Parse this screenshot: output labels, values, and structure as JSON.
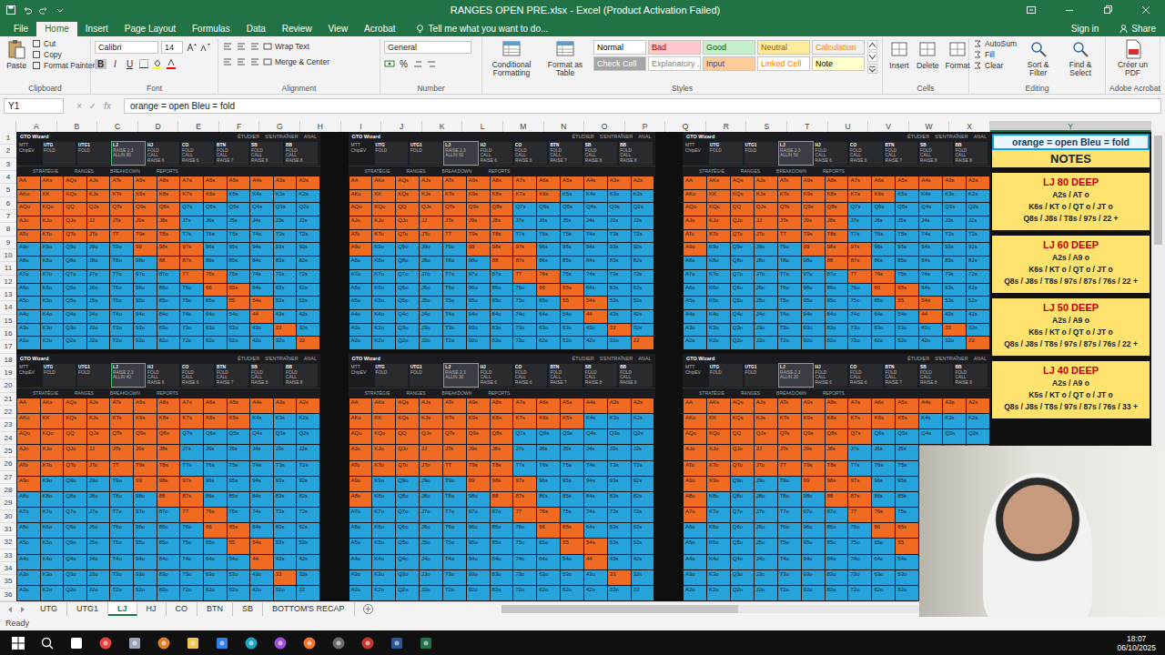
{
  "window": {
    "title": "RANGES OPEN PRE.xlsx - Excel (Product Activation Failed)",
    "sign_in": "Sign in",
    "share": "Share"
  },
  "ribbon_tabs": [
    {
      "label": "File",
      "selected": false
    },
    {
      "label": "Home",
      "selected": true
    },
    {
      "label": "Insert",
      "selected": false
    },
    {
      "label": "Page Layout",
      "selected": false
    },
    {
      "label": "Formulas",
      "selected": false
    },
    {
      "label": "Data",
      "selected": false
    },
    {
      "label": "Review",
      "selected": false
    },
    {
      "label": "View",
      "selected": false
    },
    {
      "label": "Acrobat",
      "selected": false
    }
  ],
  "tell_me": "Tell me what you want to do...",
  "ribbon_groups": [
    {
      "kind": "clipboard",
      "label": "Clipboard",
      "big": "Paste",
      "items": [
        "Cut",
        "Copy",
        "Format Painter"
      ]
    },
    {
      "kind": "font",
      "label": "Font",
      "font": "Calibri",
      "size": "14",
      "items": [
        "B",
        "I",
        "U"
      ]
    },
    {
      "kind": "alignment",
      "label": "Alignment",
      "items": [
        "Wrap Text",
        "Merge & Center"
      ]
    },
    {
      "kind": "number",
      "label": "Number",
      "format": "General",
      "items": [
        "%"
      ]
    },
    {
      "kind": "styles",
      "label": "Styles",
      "bigs": [
        "Conditional Formatting",
        "Format as Table"
      ],
      "styles": [
        {
          "label": "Normal",
          "color": "#ffffff",
          "text_color": "#000000"
        },
        {
          "label": "Bad",
          "color": "#ffc7ce",
          "text_color": "#9c0006"
        },
        {
          "label": "Good",
          "color": "#c6efce",
          "text_color": "#006100"
        },
        {
          "label": "Neutral",
          "color": "#ffeb9c",
          "text_color": "#9c5700"
        },
        {
          "label": "Calculation",
          "color": "#f2f2f2",
          "text_color": "#fa7d00"
        },
        {
          "label": "Check Cell",
          "color": "#a5a5a5",
          "text_color": "#ffffff"
        },
        {
          "label": "Explanatory ...",
          "color": "#ffffff",
          "text_color": "#7f7f7f"
        },
        {
          "label": "Input",
          "color": "#ffcc99",
          "text_color": "#3f3f76"
        },
        {
          "label": "Linked Cell",
          "color": "#ffffff",
          "text_color": "#fa7d00"
        },
        {
          "label": "Note",
          "color": "#ffffcc",
          "text_color": "#000000"
        }
      ]
    },
    {
      "kind": "cells",
      "label": "Cells",
      "items": [
        "Insert",
        "Delete",
        "Format"
      ]
    },
    {
      "kind": "editing",
      "label": "Editing",
      "items": [
        "AutoSum",
        "Fill",
        "Clear"
      ],
      "bigs": [
        "Sort & Filter",
        "Find & Select"
      ]
    },
    {
      "kind": "acrobat",
      "label": "Adobe Acrobat",
      "items": [
        "Créer un PDF"
      ]
    }
  ],
  "formula_bar": {
    "cell": "Y1",
    "buttons": [
      "×",
      "✓",
      "fx"
    ],
    "value": "orange = open  Bleu = fold"
  },
  "columns": [
    "A",
    "B",
    "C",
    "D",
    "E",
    "F",
    "G",
    "H",
    "I",
    "J",
    "K",
    "L",
    "M",
    "N",
    "O",
    "P",
    "Q",
    "R",
    "S",
    "T",
    "U",
    "V",
    "W",
    "X",
    "Y"
  ],
  "rows": [
    "1",
    "2",
    "3",
    "4",
    "5",
    "6",
    "7",
    "8",
    "9",
    "10",
    "11",
    "12",
    "13",
    "14",
    "15",
    "16",
    "17",
    "18",
    "19",
    "20",
    "21",
    "22",
    "23",
    "24",
    "25",
    "26",
    "27",
    "28",
    "29",
    "30",
    "31",
    "32",
    "33",
    "34",
    "35",
    "36"
  ],
  "gto": {
    "title": "GTO Wizard",
    "info": [
      "MTT",
      "ChipEV"
    ],
    "top_tabs": [
      "ÉTUDIER",
      "S'ENTRAÎNER",
      "ANAL"
    ],
    "nav": [
      "STRATÉGIE",
      "RANGES",
      "BREAKDOWN",
      "REPORTS"
    ]
  },
  "hand_labels": [
    [
      "AA",
      "AKs",
      "AQs",
      "AJs",
      "ATs",
      "A9s",
      "A8s",
      "A7s",
      "A6s",
      "A5s",
      "A4s",
      "A3s",
      "A2s"
    ],
    [
      "AKo",
      "KK",
      "KQs",
      "KJs",
      "KTs",
      "K9s",
      "K8s",
      "K7s",
      "K6s",
      "K5s",
      "K4s",
      "K3s",
      "K2s"
    ],
    [
      "AQo",
      "KQo",
      "QQ",
      "QJs",
      "QTs",
      "Q9s",
      "Q8s",
      "Q7s",
      "Q6s",
      "Q5s",
      "Q4s",
      "Q3s",
      "Q2s"
    ],
    [
      "AJo",
      "KJo",
      "QJo",
      "JJ",
      "JTs",
      "J9s",
      "J8s",
      "J7s",
      "J6s",
      "J5s",
      "J4s",
      "J3s",
      "J2s"
    ],
    [
      "ATo",
      "KTo",
      "QTo",
      "JTo",
      "TT",
      "T9s",
      "T8s",
      "T7s",
      "T6s",
      "T5s",
      "T4s",
      "T3s",
      "T2s"
    ],
    [
      "A9o",
      "K9o",
      "Q9o",
      "J9o",
      "T9o",
      "99",
      "98s",
      "97s",
      "96s",
      "95s",
      "94s",
      "93s",
      "92s"
    ],
    [
      "A8o",
      "K8o",
      "Q8o",
      "J8o",
      "T8o",
      "98o",
      "88",
      "87s",
      "86s",
      "85s",
      "84s",
      "83s",
      "82s"
    ],
    [
      "A7o",
      "K7o",
      "Q7o",
      "J7o",
      "T7o",
      "97o",
      "87o",
      "77",
      "76s",
      "75s",
      "74s",
      "73s",
      "72s"
    ],
    [
      "A6o",
      "K6o",
      "Q6o",
      "J6o",
      "T6o",
      "96o",
      "86o",
      "76o",
      "66",
      "65s",
      "64s",
      "63s",
      "62s"
    ],
    [
      "A5o",
      "K5o",
      "Q5o",
      "J5o",
      "T5o",
      "95o",
      "85o",
      "75o",
      "65o",
      "55",
      "54s",
      "53s",
      "52s"
    ],
    [
      "A4o",
      "K4o",
      "Q4o",
      "J4o",
      "T4o",
      "94o",
      "84o",
      "74o",
      "64o",
      "54o",
      "44",
      "43s",
      "42s"
    ],
    [
      "A3o",
      "K3o",
      "Q3o",
      "J3o",
      "T3o",
      "93o",
      "83o",
      "73o",
      "63o",
      "53o",
      "43o",
      "33",
      "32s"
    ],
    [
      "A2o",
      "K2o",
      "Q2o",
      "J2o",
      "T2o",
      "92o",
      "82o",
      "72o",
      "62o",
      "52o",
      "42o",
      "32o",
      "22"
    ]
  ],
  "grids": [
    {
      "positions": [
        {
          "name": "UTG",
          "actions": [
            "FOLD"
          ],
          "selected": false
        },
        {
          "name": "UTG1",
          "actions": [
            "FOLD"
          ],
          "selected": false
        },
        {
          "name": "LJ",
          "actions": [
            "RAISE 2.3",
            "ALLIN 80"
          ],
          "selected": true
        },
        {
          "name": "HJ",
          "actions": [
            "FOLD",
            "CALL",
            "RAISE 6"
          ],
          "selected": false
        },
        {
          "name": "CO",
          "actions": [
            "FOLD",
            "CALL",
            "RAISE 6"
          ],
          "selected": false
        },
        {
          "name": "BTN",
          "actions": [
            "FOLD",
            "CALL",
            "RAISE 7"
          ],
          "selected": false
        },
        {
          "name": "SB",
          "actions": [
            "FOLD",
            "CALL",
            "RAISE 8"
          ],
          "selected": false
        },
        {
          "name": "BB",
          "actions": [
            "FOLD",
            "CALL",
            "RAISE 8"
          ],
          "selected": false
        }
      ],
      "open": [
        "1111111111111",
        "1111111110000",
        "1111111000000",
        "1111111000000",
        "1111111000000",
        "0000011100000",
        "0000001100000",
        "0000000110000",
        "0000000011000",
        "0000000001100",
        "0000000000100",
        "0000000000010",
        "0000000000001"
      ]
    },
    {
      "positions": [
        {
          "name": "UTG",
          "actions": [
            "FOLD"
          ],
          "selected": false
        },
        {
          "name": "UTG1",
          "actions": [
            "FOLD"
          ],
          "selected": false
        },
        {
          "name": "LJ",
          "actions": [
            "RAISE 2.3",
            "ALLIN 60"
          ],
          "selected": true
        },
        {
          "name": "HJ",
          "actions": [
            "FOLD",
            "CALL",
            "RAISE 6"
          ],
          "selected": false
        },
        {
          "name": "CO",
          "actions": [
            "FOLD",
            "CALL",
            "RAISE 6"
          ],
          "selected": false
        },
        {
          "name": "BTN",
          "actions": [
            "FOLD",
            "CALL",
            "RAISE 7"
          ],
          "selected": false
        },
        {
          "name": "SB",
          "actions": [
            "FOLD",
            "CALL",
            "RAISE 8"
          ],
          "selected": false
        },
        {
          "name": "BB",
          "actions": [
            "FOLD",
            "CALL",
            "RAISE 8"
          ],
          "selected": false
        }
      ],
      "open": [
        "1111111111111",
        "1111111110000",
        "1111111000000",
        "1111111000000",
        "1111111000000",
        "1000011100000",
        "0000001100000",
        "0000000110000",
        "0000000011000",
        "0000000001100",
        "0000000000100",
        "0000000000010",
        "0000000000001"
      ]
    },
    {
      "positions": [
        {
          "name": "UTG",
          "actions": [
            "FOLD"
          ],
          "selected": false
        },
        {
          "name": "UTG1",
          "actions": [
            "FOLD"
          ],
          "selected": false
        },
        {
          "name": "LJ",
          "actions": [
            "RAISE 2.3",
            "ALLIN 50"
          ],
          "selected": true
        },
        {
          "name": "HJ",
          "actions": [
            "FOLD",
            "CALL",
            "RAISE 6"
          ],
          "selected": false
        },
        {
          "name": "CO",
          "actions": [
            "FOLD",
            "CALL",
            "RAISE 6"
          ],
          "selected": false
        },
        {
          "name": "BTN",
          "actions": [
            "FOLD",
            "CALL",
            "RAISE 7"
          ],
          "selected": false
        },
        {
          "name": "SB",
          "actions": [
            "FOLD",
            "CALL",
            "RAISE 8"
          ],
          "selected": false
        },
        {
          "name": "BB",
          "actions": [
            "FOLD",
            "CALL",
            "RAISE 8"
          ],
          "selected": false
        }
      ],
      "open": [
        "1111111111111",
        "1111111110000",
        "1111111000000",
        "1111111000000",
        "1111111000000",
        "1000011100000",
        "0000001100000",
        "0000000110000",
        "0000000011000",
        "0000000001100",
        "0000000000100",
        "0000000000010",
        "0000000000001"
      ]
    },
    {
      "positions": [
        {
          "name": "UTG",
          "actions": [
            "FOLD"
          ],
          "selected": false
        },
        {
          "name": "UTG1",
          "actions": [
            "FOLD"
          ],
          "selected": false
        },
        {
          "name": "LJ",
          "actions": [
            "RAISE 2.3",
            "ALLIN 40"
          ],
          "selected": true
        },
        {
          "name": "HJ",
          "actions": [
            "FOLD",
            "CALL",
            "RAISE 6"
          ],
          "selected": false
        },
        {
          "name": "CO",
          "actions": [
            "FOLD",
            "CALL",
            "RAISE 6"
          ],
          "selected": false
        },
        {
          "name": "BTN",
          "actions": [
            "FOLD",
            "CALL",
            "RAISE 7"
          ],
          "selected": false
        },
        {
          "name": "SB",
          "actions": [
            "FOLD",
            "CALL",
            "RAISE 8"
          ],
          "selected": false
        },
        {
          "name": "BB",
          "actions": [
            "FOLD",
            "CALL",
            "RAISE 8"
          ],
          "selected": false
        }
      ],
      "open": [
        "1111111111111",
        "1111111111000",
        "1111111000000",
        "1111111000000",
        "1111111000000",
        "1000011100000",
        "0000001100000",
        "0000000110000",
        "0000000011000",
        "0000000001100",
        "0000000000100",
        "0000000000010",
        "0000000000000"
      ]
    },
    {
      "positions": [
        {
          "name": "UTG",
          "actions": [
            "FOLD"
          ],
          "selected": false
        },
        {
          "name": "UTG1",
          "actions": [
            "FOLD"
          ],
          "selected": false
        },
        {
          "name": "LJ",
          "actions": [
            "RAISE 2.3",
            "ALLIN 30"
          ],
          "selected": true
        },
        {
          "name": "HJ",
          "actions": [
            "FOLD",
            "CALL",
            "RAISE 6"
          ],
          "selected": false
        },
        {
          "name": "CO",
          "actions": [
            "FOLD",
            "CALL",
            "RAISE 6"
          ],
          "selected": false
        },
        {
          "name": "BTN",
          "actions": [
            "FOLD",
            "CALL",
            "RAISE 7"
          ],
          "selected": false
        },
        {
          "name": "SB",
          "actions": [
            "FOLD",
            "CALL",
            "RAISE 8"
          ],
          "selected": false
        },
        {
          "name": "BB",
          "actions": [
            "FOLD",
            "CALL",
            "RAISE 8"
          ],
          "selected": false
        }
      ],
      "open": [
        "1111111111111",
        "1111111111000",
        "1111111000000",
        "1111111000000",
        "1111111000000",
        "1000011100000",
        "1000001100000",
        "0000000110000",
        "0000000011000",
        "0000000001100",
        "0000000000100",
        "0000000000010",
        "0000000000000"
      ]
    },
    {
      "positions": [
        {
          "name": "UTG",
          "actions": [
            "FOLD"
          ],
          "selected": false
        },
        {
          "name": "UTG1",
          "actions": [
            "FOLD"
          ],
          "selected": false
        },
        {
          "name": "LJ",
          "actions": [
            "RAISE 2.3",
            "ALLIN 20"
          ],
          "selected": true
        },
        {
          "name": "HJ",
          "actions": [
            "FOLD",
            "CALL",
            "RAISE 6"
          ],
          "selected": false
        },
        {
          "name": "CO",
          "actions": [
            "FOLD",
            "CALL",
            "RAISE 6"
          ],
          "selected": false
        },
        {
          "name": "BTN",
          "actions": [
            "FOLD",
            "CALL",
            "RAISE 7"
          ],
          "selected": false
        },
        {
          "name": "SB",
          "actions": [
            "FOLD",
            "CALL",
            "RAISE 8"
          ],
          "selected": false
        },
        {
          "name": "BB",
          "actions": [
            "FOLD",
            "CALL",
            "RAISE 8"
          ],
          "selected": false
        }
      ],
      "open": [
        "1111111111111",
        "1111111111000",
        "1111111100000",
        "1111111000000",
        "1111111000000",
        "1100011100000",
        "1000001100000",
        "1000000110000",
        "0000000011000",
        "0000000001100",
        "0000000000100",
        "0000000000010",
        "0000000000000"
      ]
    }
  ],
  "notes": {
    "legend": "orange = open  Bleu = fold",
    "title": "NOTES",
    "cards": [
      {
        "title": "LJ 80 DEEP",
        "lines": [
          "A2s / AT o",
          "K6s / KT o / QT o / JT o",
          "Q8s / J8s / T8s / 97s / 22 +"
        ]
      },
      {
        "title": "LJ 60 DEEP",
        "lines": [
          "A2s / A9 o",
          "K6s / KT o / QT o / JT o",
          "Q8s / J8s / T8s / 97s / 87s / 76s / 22 +"
        ]
      },
      {
        "title": "LJ 50 DEEP",
        "lines": [
          "A2s / A9 o",
          "K6s / KT o / QT o / JT o",
          "Q8s / J8s / T8s / 97s / 87s / 76s / 22 +"
        ]
      },
      {
        "title": "LJ 40 DEEP",
        "lines": [
          "A2s / A9 o",
          "K5s / KT o / QT o / JT o",
          "Q8s / J8s / T8s / 97s / 87s / 76s / 33 +"
        ]
      }
    ]
  },
  "sheet_tabs": [
    {
      "label": "UTG",
      "selected": false
    },
    {
      "label": "UTG1",
      "selected": false
    },
    {
      "label": "LJ",
      "selected": true
    },
    {
      "label": "HJ",
      "selected": false
    },
    {
      "label": "CO",
      "selected": false
    },
    {
      "label": "BTN",
      "selected": false
    },
    {
      "label": "SB",
      "selected": false
    },
    {
      "label": "BOTTOM'S RECAP",
      "selected": false
    }
  ],
  "status": "Ready",
  "taskbar": {
    "time": "18:07",
    "date": "06/10/2025"
  }
}
